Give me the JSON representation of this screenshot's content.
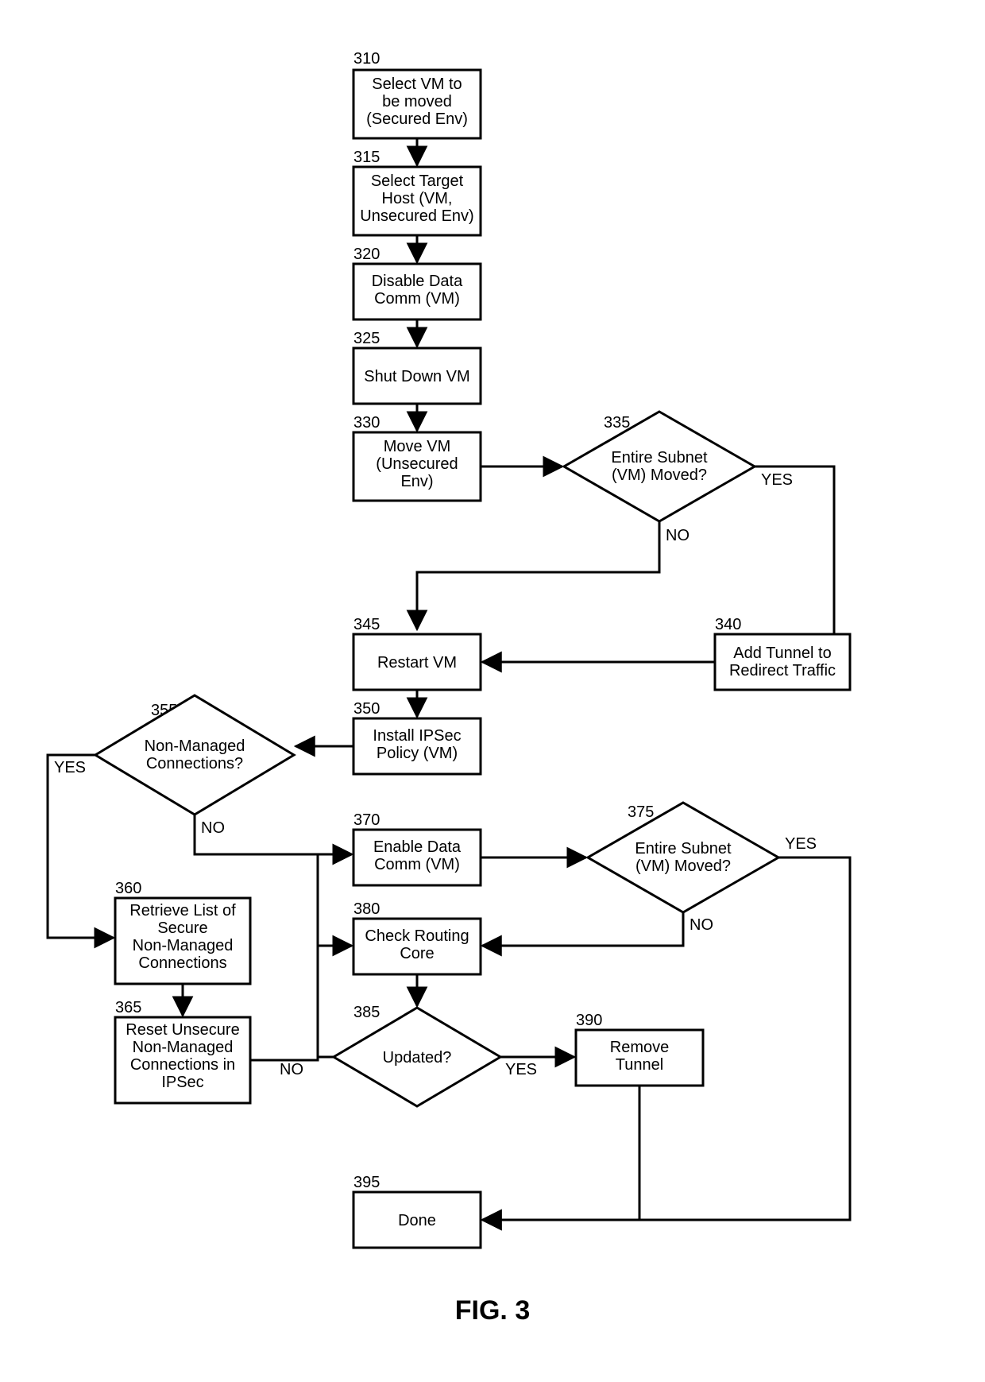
{
  "figure_label": "FIG. 3",
  "nodes": {
    "n310": {
      "num": "310",
      "lines": [
        "Select VM to",
        "be moved",
        "(Secured Env)"
      ]
    },
    "n315": {
      "num": "315",
      "lines": [
        "Select Target",
        "Host (VM,",
        "Unsecured Env)"
      ]
    },
    "n320": {
      "num": "320",
      "lines": [
        "Disable Data",
        "Comm (VM)"
      ]
    },
    "n325": {
      "num": "325",
      "lines": [
        "Shut Down VM"
      ]
    },
    "n330": {
      "num": "330",
      "lines": [
        "Move VM",
        "(Unsecured",
        "Env)"
      ]
    },
    "n335": {
      "num": "335",
      "lines": [
        "Entire Subnet",
        "(VM) Moved?"
      ]
    },
    "n340": {
      "num": "340",
      "lines": [
        "Add Tunnel to",
        "Redirect Traffic"
      ]
    },
    "n345": {
      "num": "345",
      "lines": [
        "Restart VM"
      ]
    },
    "n350": {
      "num": "350",
      "lines": [
        "Install IPSec",
        "Policy (VM)"
      ]
    },
    "n355": {
      "num": "355",
      "lines": [
        "Non-Managed",
        "Connections?"
      ]
    },
    "n360": {
      "num": "360",
      "lines": [
        "Retrieve List of",
        "Secure",
        "Non-Managed",
        "Connections"
      ]
    },
    "n365": {
      "num": "365",
      "lines": [
        "Reset Unsecure",
        "Non-Managed",
        "Connections in",
        "IPSec"
      ]
    },
    "n370": {
      "num": "370",
      "lines": [
        "Enable Data",
        "Comm (VM)"
      ]
    },
    "n375": {
      "num": "375",
      "lines": [
        "Entire Subnet",
        "(VM) Moved?"
      ]
    },
    "n380": {
      "num": "380",
      "lines": [
        "Check Routing",
        "Core"
      ]
    },
    "n385": {
      "num": "385",
      "lines": [
        "Updated?"
      ]
    },
    "n390": {
      "num": "390",
      "lines": [
        "Remove",
        "Tunnel"
      ]
    },
    "n395": {
      "num": "395",
      "lines": [
        "Done"
      ]
    }
  },
  "edge_labels": {
    "yes": "YES",
    "no": "NO"
  },
  "chart_data": {
    "type": "flowchart",
    "title": "FIG. 3",
    "nodes": [
      {
        "id": "310",
        "shape": "process",
        "text": "Select VM to be moved (Secured Env)"
      },
      {
        "id": "315",
        "shape": "process",
        "text": "Select Target Host (VM, Unsecured Env)"
      },
      {
        "id": "320",
        "shape": "process",
        "text": "Disable Data Comm (VM)"
      },
      {
        "id": "325",
        "shape": "process",
        "text": "Shut Down VM"
      },
      {
        "id": "330",
        "shape": "process",
        "text": "Move VM (Unsecured Env)"
      },
      {
        "id": "335",
        "shape": "decision",
        "text": "Entire Subnet (VM) Moved?"
      },
      {
        "id": "340",
        "shape": "process",
        "text": "Add Tunnel to Redirect Traffic"
      },
      {
        "id": "345",
        "shape": "process",
        "text": "Restart VM"
      },
      {
        "id": "350",
        "shape": "process",
        "text": "Install IPSec Policy (VM)"
      },
      {
        "id": "355",
        "shape": "decision",
        "text": "Non-Managed Connections?"
      },
      {
        "id": "360",
        "shape": "process",
        "text": "Retrieve List of Secure Non-Managed Connections"
      },
      {
        "id": "365",
        "shape": "process",
        "text": "Reset Unsecure Non-Managed Connections in IPSec"
      },
      {
        "id": "370",
        "shape": "process",
        "text": "Enable Data Comm (VM)"
      },
      {
        "id": "375",
        "shape": "decision",
        "text": "Entire Subnet (VM) Moved?"
      },
      {
        "id": "380",
        "shape": "process",
        "text": "Check Routing Core"
      },
      {
        "id": "385",
        "shape": "decision",
        "text": "Updated?"
      },
      {
        "id": "390",
        "shape": "process",
        "text": "Remove Tunnel"
      },
      {
        "id": "395",
        "shape": "terminator",
        "text": "Done"
      }
    ],
    "edges": [
      {
        "from": "310",
        "to": "315"
      },
      {
        "from": "315",
        "to": "320"
      },
      {
        "from": "320",
        "to": "325"
      },
      {
        "from": "325",
        "to": "330"
      },
      {
        "from": "330",
        "to": "335"
      },
      {
        "from": "335",
        "to": "345",
        "label": "NO"
      },
      {
        "from": "335",
        "to": "340",
        "label": "YES"
      },
      {
        "from": "340",
        "to": "345"
      },
      {
        "from": "345",
        "to": "350"
      },
      {
        "from": "350",
        "to": "355"
      },
      {
        "from": "355",
        "to": "370",
        "label": "NO"
      },
      {
        "from": "355",
        "to": "360",
        "label": "YES"
      },
      {
        "from": "360",
        "to": "365"
      },
      {
        "from": "365",
        "to": "370"
      },
      {
        "from": "370",
        "to": "375"
      },
      {
        "from": "375",
        "to": "380",
        "label": "NO"
      },
      {
        "from": "375",
        "to": "395",
        "label": "YES"
      },
      {
        "from": "380",
        "to": "385"
      },
      {
        "from": "385",
        "to": "380",
        "label": "NO"
      },
      {
        "from": "385",
        "to": "390",
        "label": "YES"
      },
      {
        "from": "390",
        "to": "395"
      }
    ]
  }
}
